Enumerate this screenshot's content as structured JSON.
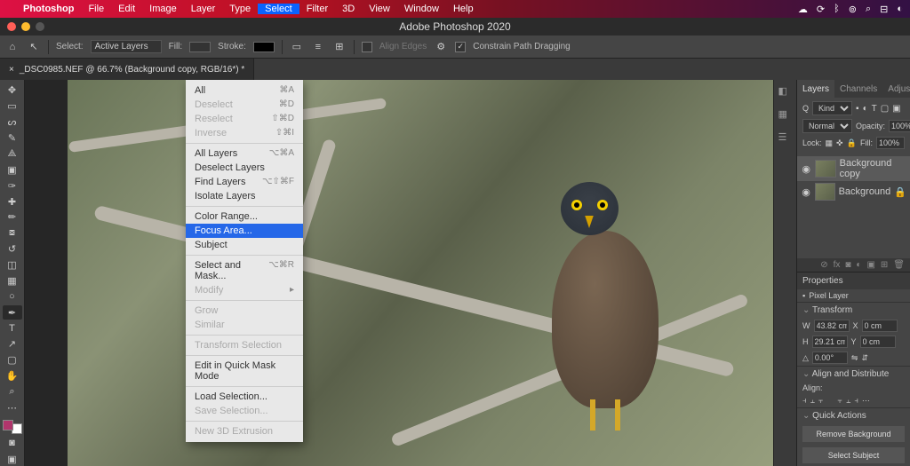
{
  "menubar": {
    "app": "Photoshop",
    "items": [
      "File",
      "Edit",
      "Image",
      "Layer",
      "Type",
      "Select",
      "Filter",
      "3D",
      "View",
      "Window",
      "Help"
    ],
    "open_index": 5
  },
  "window_title": "Adobe Photoshop 2020",
  "option_bar": {
    "select_label": "Select:",
    "select_value": "Active Layers",
    "fill_label": "Fill:",
    "stroke_label": "Stroke:",
    "align_label": "Align Edges",
    "constrain_label": "Constrain Path Dragging"
  },
  "doc_tab": "_DSC0985.NEF @ 66.7% (Background copy, RGB/16*) *",
  "dropdown": [
    {
      "label": "All",
      "sc": "⌘A"
    },
    {
      "label": "Deselect",
      "sc": "⌘D",
      "dis": true
    },
    {
      "label": "Reselect",
      "sc": "⇧⌘D",
      "dis": true
    },
    {
      "label": "Inverse",
      "sc": "⇧⌘I",
      "dis": true
    },
    {
      "sep": true
    },
    {
      "label": "All Layers",
      "sc": "⌥⌘A"
    },
    {
      "label": "Deselect Layers"
    },
    {
      "label": "Find Layers",
      "sc": "⌥⇧⌘F"
    },
    {
      "label": "Isolate Layers"
    },
    {
      "sep": true
    },
    {
      "label": "Color Range..."
    },
    {
      "label": "Focus Area...",
      "hl": true
    },
    {
      "label": "Subject"
    },
    {
      "sep": true
    },
    {
      "label": "Select and Mask...",
      "sc": "⌥⌘R"
    },
    {
      "label": "Modify",
      "sub": true,
      "dis": true
    },
    {
      "sep": true
    },
    {
      "label": "Grow",
      "dis": true
    },
    {
      "label": "Similar",
      "dis": true
    },
    {
      "sep": true
    },
    {
      "label": "Transform Selection",
      "dis": true
    },
    {
      "sep": true
    },
    {
      "label": "Edit in Quick Mask Mode"
    },
    {
      "sep": true
    },
    {
      "label": "Load Selection..."
    },
    {
      "label": "Save Selection...",
      "dis": true
    },
    {
      "sep": true
    },
    {
      "label": "New 3D Extrusion",
      "dis": true
    }
  ],
  "layers_panel": {
    "tabs": [
      "Layers",
      "Channels",
      "Adjustments"
    ],
    "kind_label": "Kind",
    "blend": "Normal",
    "opacity_label": "Opacity:",
    "opacity": "100%",
    "lock_label": "Lock:",
    "fill_label": "Fill:",
    "fill": "100%",
    "layers": [
      {
        "name": "Background copy",
        "sel": true
      },
      {
        "name": "Background"
      }
    ]
  },
  "properties": {
    "title": "Properties",
    "type": "Pixel Layer",
    "transform": "Transform",
    "w": "43.82 cm",
    "x": "0 cm",
    "h": "29.21 cm",
    "y": "0 cm",
    "angle": "0.00°",
    "align": "Align and Distribute",
    "align_label": "Align:",
    "qa": "Quick Actions",
    "qa_remove": "Remove Background",
    "qa_subject": "Select Subject"
  }
}
